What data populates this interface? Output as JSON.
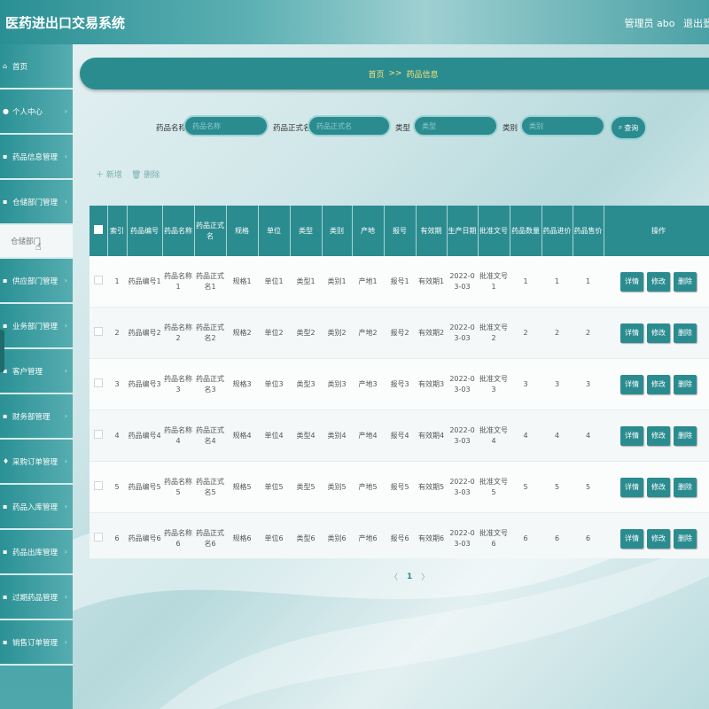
{
  "header": {
    "app_title": "医药进出口交易系统",
    "user_role": "管理员 abo",
    "logout": "退出登"
  },
  "sidebar": {
    "items": [
      {
        "label": "首页",
        "icon": "home-icon",
        "glyph": "⌂",
        "chevron": false
      },
      {
        "label": "个人中心",
        "icon": "user-icon",
        "glyph": "●",
        "chevron": true
      },
      {
        "label": "药品信息管理",
        "icon": "grid-icon",
        "glyph": "▪",
        "chevron": true
      },
      {
        "label": "仓储部门管理",
        "icon": "grid-icon",
        "glyph": "▪",
        "chevron": true
      },
      {
        "label": "供应部门管理",
        "icon": "grid-icon",
        "glyph": "▪",
        "chevron": true
      },
      {
        "label": "业务部门管理",
        "icon": "grid-icon",
        "glyph": "▪",
        "chevron": true
      },
      {
        "label": "客户管理",
        "icon": "lock-icon",
        "glyph": "▪",
        "chevron": true
      },
      {
        "label": "财务部管理",
        "icon": "card-icon",
        "glyph": "▪",
        "chevron": true
      },
      {
        "label": "采购订单管理",
        "icon": "pin-icon",
        "glyph": "♦",
        "chevron": true
      },
      {
        "label": "药品入库管理",
        "icon": "grid-icon",
        "glyph": "▪",
        "chevron": true
      },
      {
        "label": "药品出库管理",
        "icon": "grid-icon",
        "glyph": "▪",
        "chevron": true
      },
      {
        "label": "过期药品管理",
        "icon": "grid-icon",
        "glyph": "▪",
        "chevron": true
      },
      {
        "label": "销售订单管理",
        "icon": "grid-icon",
        "glyph": "▪",
        "chevron": true
      }
    ],
    "submenu": "仓储部门"
  },
  "breadcrumb": {
    "home": "首页",
    "separator": ">>",
    "current": "药品信息"
  },
  "search": {
    "fields": [
      {
        "label": "药品名称",
        "placeholder": "药品名称"
      },
      {
        "label": "药品正式名",
        "placeholder": "药品正式名"
      },
      {
        "label": "类型",
        "placeholder": "类型"
      },
      {
        "label": "类别",
        "placeholder": "类别"
      }
    ],
    "query_label": "查询"
  },
  "actions": {
    "add": "新增",
    "delete": "删除"
  },
  "table": {
    "headers": [
      "索引",
      "药品编号",
      "药品名称",
      "药品正式名",
      "规格",
      "单位",
      "类型",
      "类别",
      "产地",
      "报号",
      "有效期",
      "生产日期",
      "批准文号",
      "药品数量",
      "药品进价",
      "药品售价",
      "操作"
    ],
    "rows": [
      [
        "1",
        "药品编号1",
        "药品名称1",
        "药品正式名1",
        "规格1",
        "单位1",
        "类型1",
        "类别1",
        "产地1",
        "报号1",
        "有效期1",
        "2022-03-03",
        "批准文号1",
        "1",
        "1",
        "1"
      ],
      [
        "2",
        "药品编号2",
        "药品名称2",
        "药品正式名2",
        "规格2",
        "单位2",
        "类型2",
        "类别2",
        "产地2",
        "报号2",
        "有效期2",
        "2022-03-03",
        "批准文号2",
        "2",
        "2",
        "2"
      ],
      [
        "3",
        "药品编号3",
        "药品名称3",
        "药品正式名3",
        "规格3",
        "单位3",
        "类型3",
        "类别3",
        "产地3",
        "报号3",
        "有效期3",
        "2022-03-03",
        "批准文号3",
        "3",
        "3",
        "3"
      ],
      [
        "4",
        "药品编号4",
        "药品名称4",
        "药品正式名4",
        "规格4",
        "单位4",
        "类型4",
        "类别4",
        "产地4",
        "报号4",
        "有效期4",
        "2022-03-03",
        "批准文号4",
        "4",
        "4",
        "4"
      ],
      [
        "5",
        "药品编号5",
        "药品名称5",
        "药品正式名5",
        "规格5",
        "单位5",
        "类型5",
        "类别5",
        "产地5",
        "报号5",
        "有效期5",
        "2022-03-03",
        "批准文号5",
        "5",
        "5",
        "5"
      ],
      [
        "6",
        "药品编号6",
        "药品名称6",
        "药品正式名6",
        "规格6",
        "单位6",
        "类型6",
        "类别6",
        "产地6",
        "报号6",
        "有效期6",
        "2022-03-03",
        "批准文号6",
        "6",
        "6",
        "6"
      ]
    ],
    "row_buttons": [
      "详情",
      "修改",
      "删除"
    ]
  },
  "pagination": {
    "prev": "〈",
    "current": "1",
    "next": "〉"
  },
  "colors": {
    "primary": "#2b8c90",
    "breadcrumb_text": "#f6e27a"
  }
}
